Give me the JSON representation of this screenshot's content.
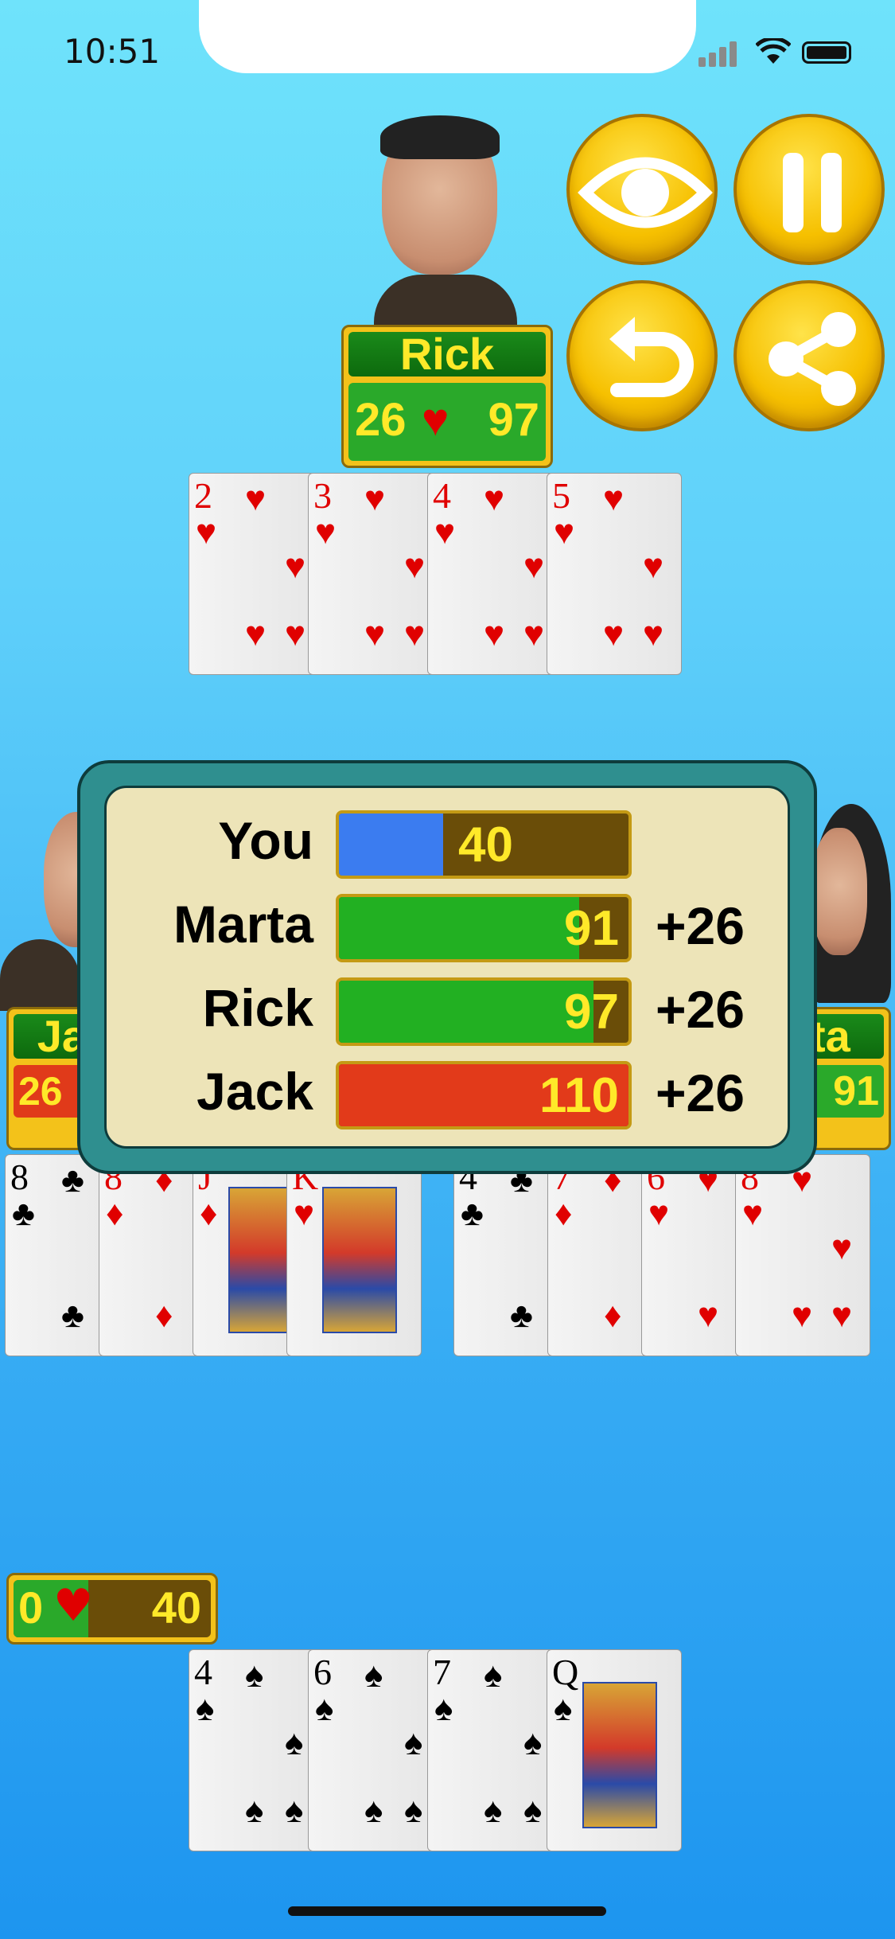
{
  "status_bar": {
    "time": "10:51"
  },
  "players": {
    "top": {
      "name": "Rick",
      "hearts": "26",
      "total": "97"
    },
    "left": {
      "name_partial": "Ja",
      "hearts_partial": "26"
    },
    "right": {
      "name_partial": "ta",
      "total_partial": "91"
    },
    "you": {
      "hearts": "0",
      "total": "40"
    }
  },
  "controls": {
    "view_icon": "eye-icon",
    "pause_icon": "pause-icon",
    "undo_icon": "undo-icon",
    "share_icon": "share-icon"
  },
  "scoreboard": {
    "rows": [
      {
        "name": "You",
        "score": "40",
        "delta": "",
        "fraction": 0.36,
        "color": "#3b7cf0"
      },
      {
        "name": "Marta",
        "score": "91",
        "delta": "+26",
        "fraction": 0.83,
        "color": "#22b022"
      },
      {
        "name": "Rick",
        "score": "97",
        "delta": "+26",
        "fraction": 0.88,
        "color": "#22b022"
      },
      {
        "name": "Jack",
        "score": "110",
        "delta": "+26",
        "fraction": 1.0,
        "color": "#e23a1a"
      }
    ]
  },
  "cards": {
    "top_trick": [
      {
        "rank": "2",
        "suit": "♥"
      },
      {
        "rank": "3",
        "suit": "♥"
      },
      {
        "rank": "4",
        "suit": "♥"
      },
      {
        "rank": "5",
        "suit": "♥"
      }
    ],
    "left_pile": [
      {
        "rank": "8",
        "suit": "♣"
      },
      {
        "rank": "8",
        "suit": "♦"
      },
      {
        "rank": "J",
        "suit": "♦"
      },
      {
        "rank": "K",
        "suit": "♥"
      }
    ],
    "right_pile": [
      {
        "rank": "4",
        "suit": "♣"
      },
      {
        "rank": "7",
        "suit": "♦"
      },
      {
        "rank": "6",
        "suit": "♥"
      },
      {
        "rank": "8",
        "suit": "♥"
      }
    ],
    "your_hand": [
      {
        "rank": "4",
        "suit": "♠"
      },
      {
        "rank": "6",
        "suit": "♠"
      },
      {
        "rank": "7",
        "suit": "♠"
      },
      {
        "rank": "Q",
        "suit": "♠"
      }
    ]
  }
}
